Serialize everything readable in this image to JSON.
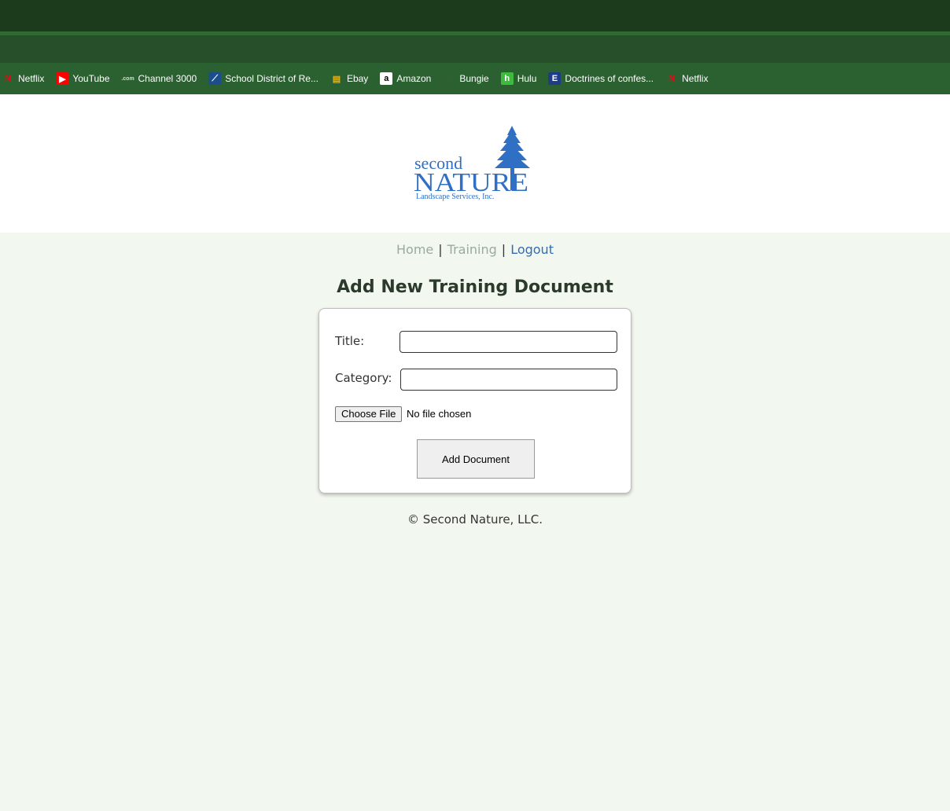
{
  "bookmarks": [
    {
      "label": "Netflix",
      "icon": "netflix-icon",
      "glyph": "N",
      "color": "#e50914",
      "bg": "transparent"
    },
    {
      "label": "YouTube",
      "icon": "youtube-icon",
      "glyph": "▶",
      "color": "#ffffff",
      "bg": "#ff0000"
    },
    {
      "label": "Channel 3000",
      "icon": "channel3000-icon",
      "glyph": ".com",
      "color": "#dddddd",
      "bg": "transparent"
    },
    {
      "label": "School District of Re...",
      "icon": "school-district-icon",
      "glyph": "⟋",
      "color": "#ffffff",
      "bg": "#1c4d8c"
    },
    {
      "label": "Ebay",
      "icon": "ebay-icon",
      "glyph": "▤",
      "color": "#f5af02",
      "bg": "transparent"
    },
    {
      "label": "Amazon",
      "icon": "amazon-icon",
      "glyph": "a",
      "color": "#000000",
      "bg": "#ffffff"
    },
    {
      "label": "Bungie",
      "icon": "bungie-icon",
      "glyph": "◌",
      "color": "#555555",
      "bg": "transparent"
    },
    {
      "label": "Hulu",
      "icon": "hulu-icon",
      "glyph": "h",
      "color": "#ffffff",
      "bg": "#3dbb3d"
    },
    {
      "label": "Doctrines of confes...",
      "icon": "doctrines-icon",
      "glyph": "E",
      "color": "#ffffff",
      "bg": "#1f3c88"
    },
    {
      "label": "Netflix",
      "icon": "netflix-icon",
      "glyph": "N",
      "color": "#e50914",
      "bg": "transparent"
    }
  ],
  "logo": {
    "line1": "second",
    "line2": "NATURE",
    "line3": "Landscape Services, Inc.",
    "color": "#2f6fc4"
  },
  "nav": {
    "home": "Home",
    "training": "Training",
    "logout": "Logout",
    "sep": "|"
  },
  "page_title": "Add New Training Document",
  "form": {
    "title_label": "Title:",
    "title_value": "",
    "category_label": "Category:",
    "category_value": "",
    "file_button": "Choose File",
    "file_status": "No file chosen",
    "submit_label": "Add Document"
  },
  "footer": "© Second Nature, LLC."
}
